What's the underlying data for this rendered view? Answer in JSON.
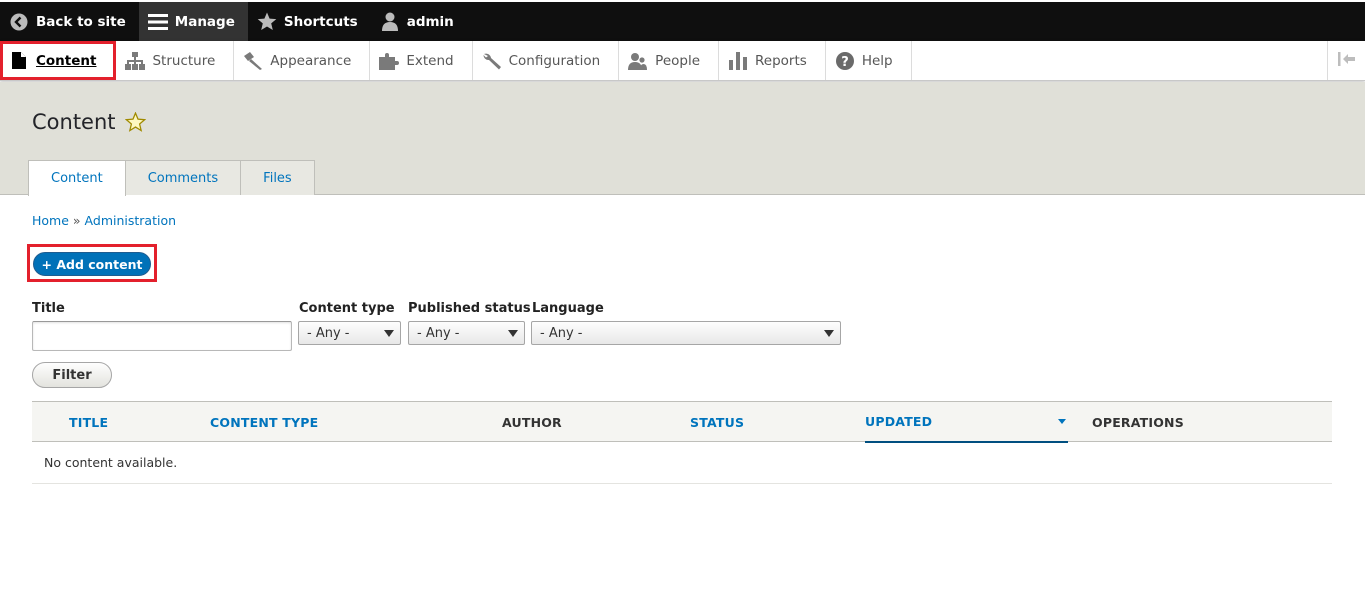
{
  "toolbar": {
    "back_to_site": "Back to site",
    "manage": "Manage",
    "shortcuts": "Shortcuts",
    "user": "admin"
  },
  "tray": {
    "items": [
      {
        "label": "Content",
        "icon": "file-icon"
      },
      {
        "label": "Structure",
        "icon": "sitemap-icon"
      },
      {
        "label": "Appearance",
        "icon": "paintbrush-icon"
      },
      {
        "label": "Extend",
        "icon": "puzzle-icon"
      },
      {
        "label": "Configuration",
        "icon": "wrench-icon"
      },
      {
        "label": "People",
        "icon": "people-icon"
      },
      {
        "label": "Reports",
        "icon": "bar-chart-icon"
      },
      {
        "label": "Help",
        "icon": "help-icon"
      }
    ]
  },
  "page": {
    "title": "Content",
    "tabs": [
      "Content",
      "Comments",
      "Files"
    ]
  },
  "breadcrumb": {
    "home": "Home",
    "separator": "»",
    "admin": "Administration"
  },
  "actions": {
    "add_content": "+ Add content"
  },
  "filters": {
    "title_label": "Title",
    "title_value": "",
    "content_type_label": "Content type",
    "content_type_value": "- Any -",
    "published_label": "Published status",
    "published_value": "- Any -",
    "language_label": "Language",
    "language_value": "- Any -",
    "filter_button": "Filter"
  },
  "table": {
    "headers": [
      "TITLE",
      "CONTENT TYPE",
      "AUTHOR",
      "STATUS",
      "UPDATED",
      "OPERATIONS"
    ],
    "empty": "No content available."
  },
  "colors": {
    "accent": "#0074bd",
    "highlight": "#e3202c",
    "toolbar_bg": "#0f0f0f"
  }
}
